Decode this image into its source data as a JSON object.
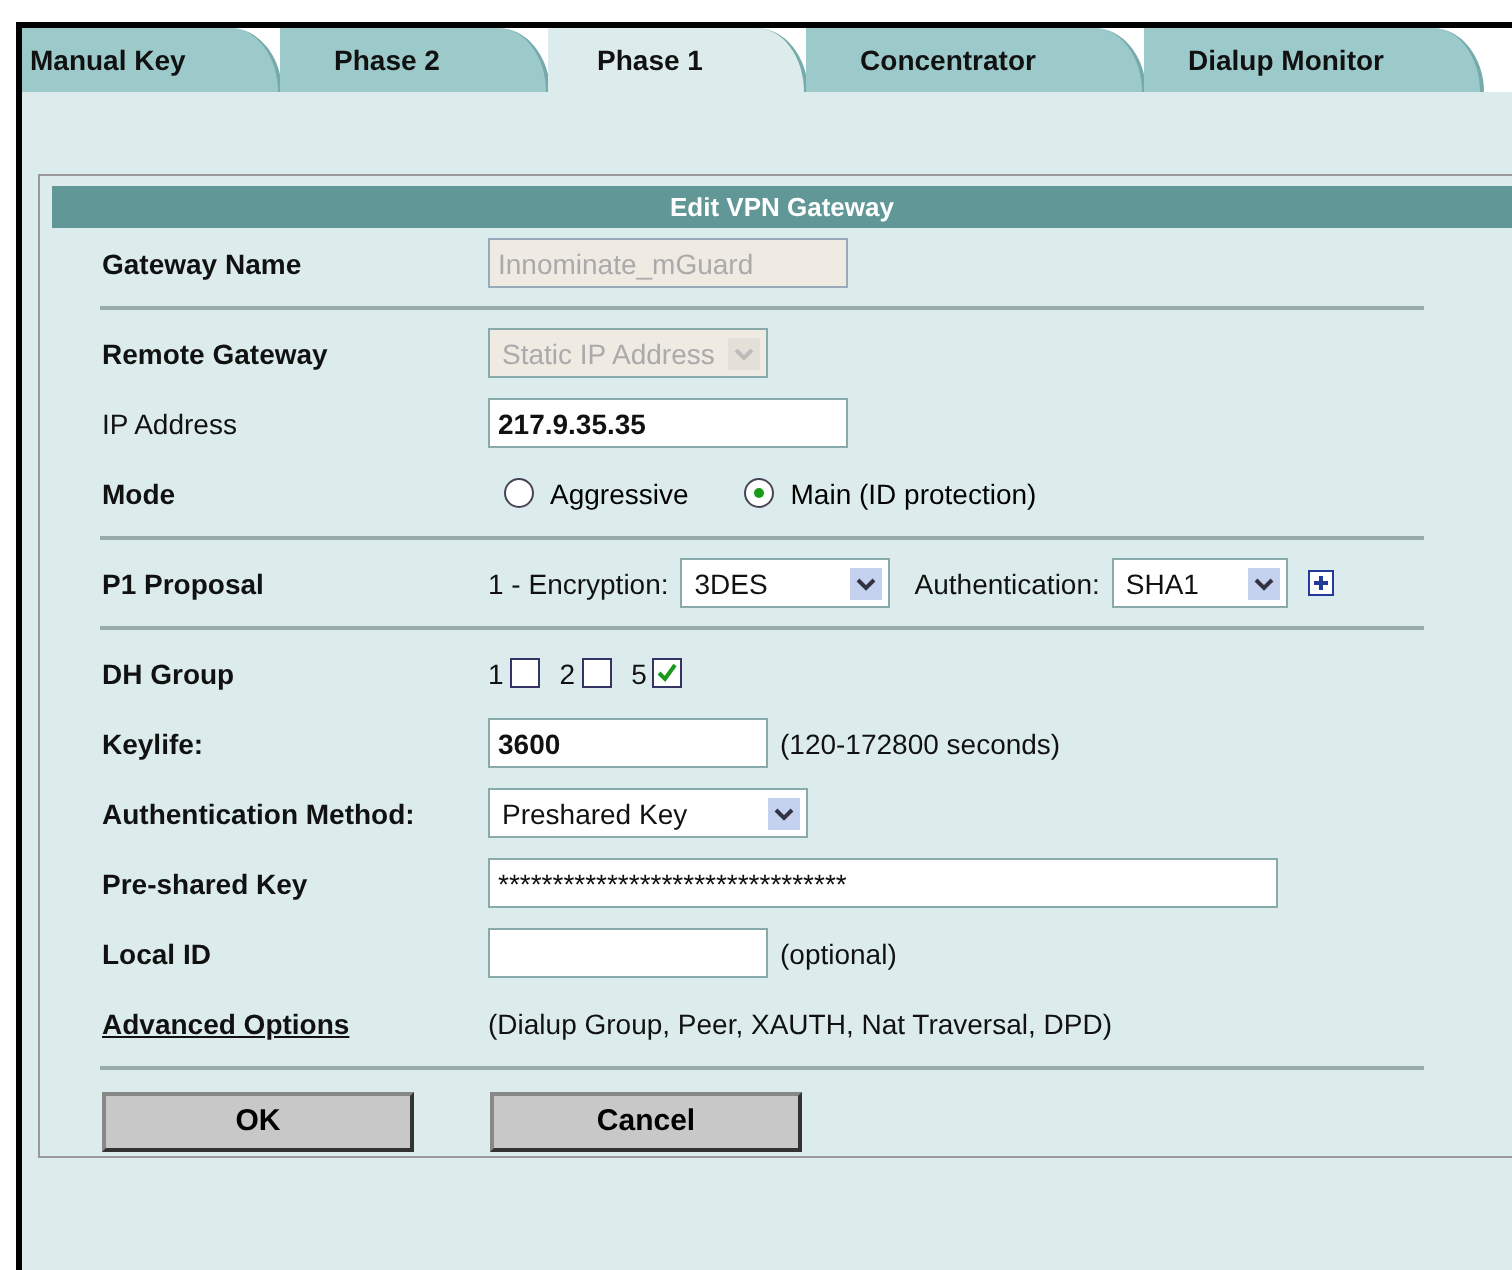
{
  "tabs": [
    {
      "label": "Manual Key",
      "selected": false
    },
    {
      "label": "Phase 2",
      "selected": false
    },
    {
      "label": "Phase 1",
      "selected": true
    },
    {
      "label": "Concentrator",
      "selected": false
    },
    {
      "label": "Dialup Monitor",
      "selected": false
    }
  ],
  "form": {
    "title": "Edit VPN Gateway",
    "gateway_name": {
      "label": "Gateway Name",
      "value": "Innominate_mGuard",
      "disabled": true
    },
    "remote_gateway": {
      "label": "Remote Gateway",
      "value": "Static IP Address",
      "disabled": true
    },
    "ip_address": {
      "label": "IP Address",
      "value": "217.9.35.35"
    },
    "mode": {
      "label": "Mode",
      "options": [
        {
          "label": "Aggressive",
          "selected": false
        },
        {
          "label": "Main (ID protection)",
          "selected": true
        }
      ]
    },
    "p1_proposal": {
      "label": "P1 Proposal",
      "prefix": "1 - Encryption:",
      "encryption": "3DES",
      "auth_label": "Authentication:",
      "authentication": "SHA1"
    },
    "dh_group": {
      "label": "DH Group",
      "options": [
        {
          "label": "1",
          "checked": false
        },
        {
          "label": "2",
          "checked": false
        },
        {
          "label": "5",
          "checked": true
        }
      ]
    },
    "keylife": {
      "label": "Keylife:",
      "value": "3600",
      "hint": "(120-172800 seconds)"
    },
    "auth_method": {
      "label": "Authentication Method:",
      "value": "Preshared Key"
    },
    "psk": {
      "label": "Pre-shared Key",
      "value": "********************************"
    },
    "local_id": {
      "label": "Local ID",
      "hint": "(optional)"
    },
    "advanced": {
      "label": "Advanced Options",
      "hint": "(Dialup Group, Peer, XAUTH, Nat Traversal, DPD)"
    },
    "buttons": [
      "OK",
      "Cancel"
    ]
  }
}
